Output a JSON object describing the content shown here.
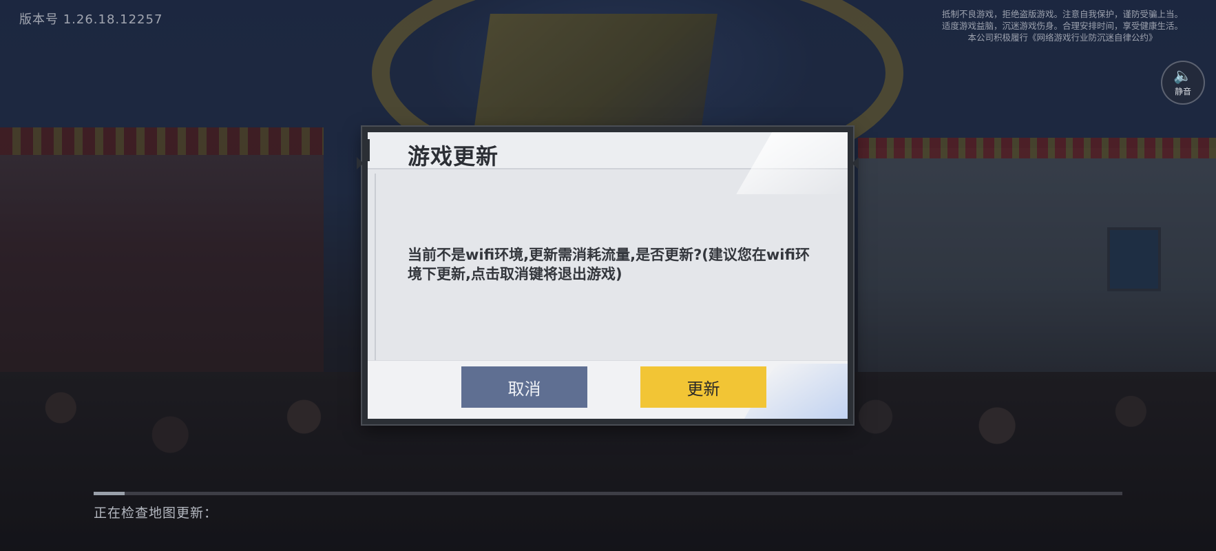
{
  "version": "版本号 1.26.18.12257",
  "notice_lines": [
    "抵制不良游戏，拒绝盗版游戏。注意自我保护，谨防受骗上当。",
    "适度游戏益脑，沉迷游戏伤身。合理安排时间，享受健康生活。",
    "本公司积极履行《网络游戏行业防沉迷自律公约》"
  ],
  "sound_button": {
    "icon": "speaker-icon",
    "label": "静音"
  },
  "dialog": {
    "title": "游戏更新",
    "message": "当前不是wifi环境,更新需消耗流量,是否更新?(建议您在wifi环境下更新,点击取消键将退出游戏)",
    "cancel_label": "取消",
    "update_label": "更新",
    "colors": {
      "cancel": "#5f6f92",
      "update": "#f2c535"
    }
  },
  "status": {
    "text": "正在检查地图更新：",
    "progress": 0.03
  }
}
